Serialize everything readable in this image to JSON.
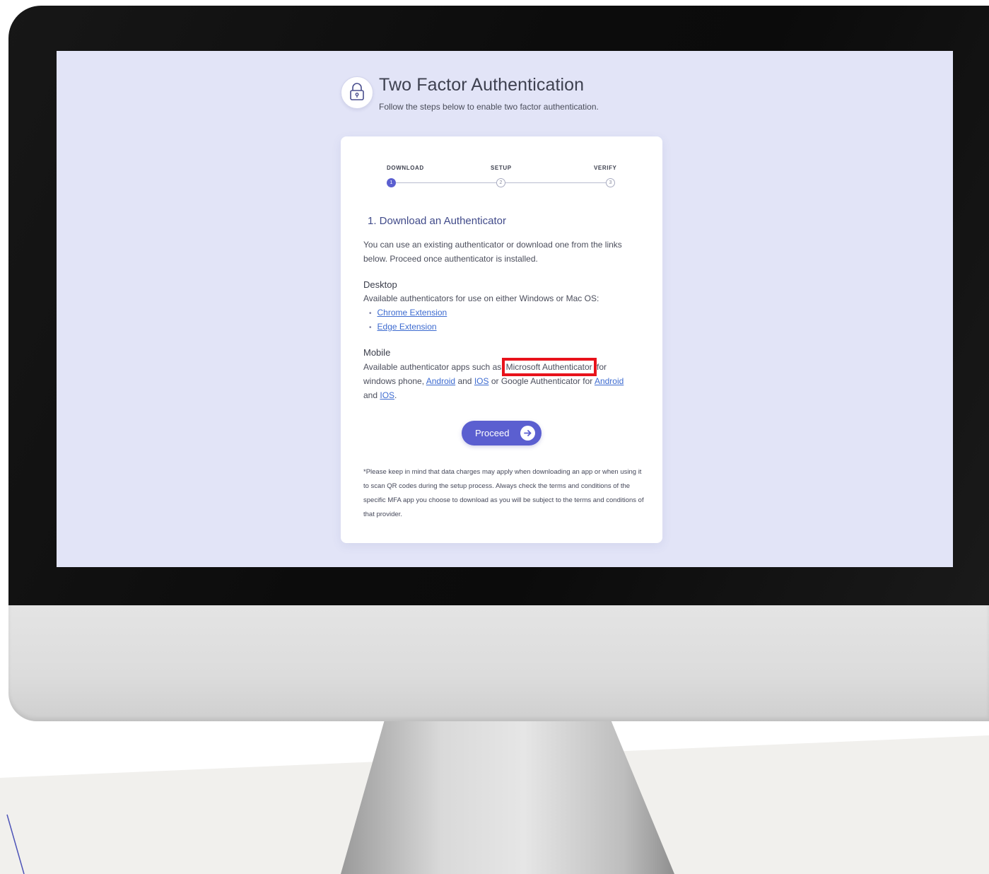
{
  "header": {
    "title": "Two Factor Authentication",
    "subtitle": "Follow the steps below to enable two factor authentication."
  },
  "steps": [
    {
      "label": "DOWNLOAD",
      "number": "1",
      "active": true
    },
    {
      "label": "SETUP",
      "number": "2",
      "active": false
    },
    {
      "label": "VERIFY",
      "number": "3",
      "active": false
    }
  ],
  "section": {
    "title": "1. Download an Authenticator",
    "intro_line1": "You can use an existing authenticator or download one from the links",
    "intro_line2": "below. Proceed once authenticator is installed."
  },
  "desktop": {
    "heading": "Desktop",
    "description": "Available authenticators for use on either Windows or Mac OS:",
    "links": [
      "Chrome Extension",
      "Edge Extension"
    ]
  },
  "mobile": {
    "heading": "Mobile",
    "text_before": "Available authenticator apps such as",
    "highlight": "Microsoft Authenticator",
    "text_after": "for",
    "line2_prefix": "windows phone,",
    "link_android_1": "Android",
    "and_1": "and",
    "link_ios_1": "IOS",
    "mid_text": "or Google Authenticator for",
    "link_android_2": "Android",
    "and_2": "and",
    "link_ios_2": "IOS",
    "period": "."
  },
  "proceed_label": "Proceed",
  "footnote": "*Please keep in mind that data charges may apply when downloading an app or when using it to scan QR codes during the setup process. Always check the terms and conditions of the specific MFA app you choose to download as you will be subject to the terms and conditions of that provider.",
  "colors": {
    "accent": "#5b5fd0",
    "screen_bg": "#e2e4f7",
    "link": "#3d6bd0",
    "highlight_box": "#e8131b"
  },
  "icons": {
    "header": "lock-icon",
    "proceed": "arrow-right-icon"
  }
}
